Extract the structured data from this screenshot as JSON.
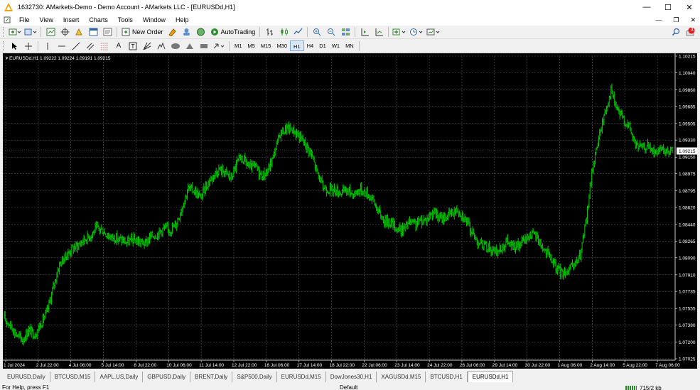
{
  "window": {
    "title": "1632730: AMarkets-Demo - Demo Account - AMarkets LLC - [EURUSDd,H1]",
    "min_label": "—",
    "max_label": "☐",
    "close_label": "✕"
  },
  "menu": {
    "items": [
      "File",
      "View",
      "Insert",
      "Charts",
      "Tools",
      "Window",
      "Help"
    ],
    "mdi_min": "—",
    "mdi_restore": "❐",
    "mdi_close": "✕"
  },
  "toolbar": {
    "new_order_label": "New Order",
    "autotrading_label": "AutoTrading",
    "notification_count": "1"
  },
  "timeframes": [
    {
      "label": "M1",
      "active": false
    },
    {
      "label": "M5",
      "active": false
    },
    {
      "label": "M15",
      "active": false
    },
    {
      "label": "M30",
      "active": false
    },
    {
      "label": "H1",
      "active": true
    },
    {
      "label": "H4",
      "active": false
    },
    {
      "label": "D1",
      "active": false
    },
    {
      "label": "W1",
      "active": false
    },
    {
      "label": "MN",
      "active": false
    }
  ],
  "chart": {
    "header": "EURUSDd,H1  1.09222 1.09224 1.09191 1.09215",
    "current_price": "1.09215",
    "colors": {
      "background": "#000000",
      "grid": "#5a5a5a",
      "candles": "#00c800",
      "axis_text": "#ffffff",
      "price_marker_bg": "#ffffff"
    }
  },
  "chart_data": {
    "type": "line",
    "title": "EURUSDd,H1",
    "ylim": [
      1.07025,
      1.10215
    ],
    "y_ticks": [
      "1.10215",
      "1.10040",
      "1.09860",
      "1.09685",
      "1.09505",
      "1.09330",
      "1.09150",
      "1.08975",
      "1.08795",
      "1.08620",
      "1.08440",
      "1.08265",
      "1.08090",
      "1.07910",
      "1.07735",
      "1.07555",
      "1.07380",
      "1.07200",
      "1.07025"
    ],
    "x_ticks": [
      "1 Jul 2024",
      "2 Jul 22:00",
      "4 Jul 06:00",
      "5 Jul 14:00",
      "8 Jul 22:00",
      "10 Jul 06:00",
      "11 Jul 14:00",
      "12 Jul 22:00",
      "16 Jul 06:00",
      "17 Jul 14:00",
      "18 Jul 22:00",
      "22 Jul 06:00",
      "23 Jul 14:00",
      "24 Jul 22:00",
      "26 Jul 06:00",
      "29 Jul 14:00",
      "30 Jul 22:00",
      "1 Aug 06:00",
      "2 Aug 14:00",
      "5 Aug 22:00",
      "7 Aug 06:00"
    ],
    "grid": true,
    "series": [
      {
        "values": [
          1.0745,
          1.0738,
          1.0728,
          1.0722,
          1.0733,
          1.0728,
          1.074,
          1.0752,
          1.0778,
          1.0802,
          1.081,
          1.0818,
          1.0822,
          1.0828,
          1.0832,
          1.084,
          1.0838,
          1.0832,
          1.083,
          1.0828,
          1.0825,
          1.0828,
          1.0826,
          1.0824,
          1.0832,
          1.0834,
          1.084,
          1.0838,
          1.0844,
          1.0862,
          1.0882,
          1.088,
          1.0872,
          1.0885,
          1.0895,
          1.0902,
          1.09,
          1.0892,
          1.091,
          1.0913,
          1.0904,
          1.0905,
          1.0895,
          1.09,
          1.0918,
          1.094,
          1.0945,
          1.0944,
          1.0938,
          1.093,
          1.092,
          1.09,
          1.0883,
          1.0881,
          1.088,
          1.0878,
          1.088,
          1.0876,
          1.0881,
          1.0878,
          1.0872,
          1.0858,
          1.0848,
          1.0847,
          1.084,
          1.0838,
          1.0846,
          1.0844,
          1.0848,
          1.085,
          1.0858,
          1.085,
          1.0852,
          1.0856,
          1.086,
          1.0852,
          1.084,
          1.0828,
          1.0822,
          1.082,
          1.0814,
          1.0818,
          1.0826,
          1.082,
          1.0822,
          1.0828,
          1.0834,
          1.083,
          1.0818,
          1.081,
          1.0798,
          1.0793,
          1.0796,
          1.08,
          1.0812,
          1.085,
          1.0905,
          1.0935,
          1.0962,
          1.0985,
          1.0965,
          1.0955,
          1.0947,
          1.0928,
          1.0925,
          1.0927,
          1.092,
          1.0921,
          1.092,
          1.0922
        ]
      }
    ]
  },
  "tabs": [
    {
      "label": "EURUSD,Daily",
      "active": false
    },
    {
      "label": "BTCUSD,M15",
      "active": false
    },
    {
      "label": "AAPL.US,Daily",
      "active": false
    },
    {
      "label": "GBPUSD,Daily",
      "active": false
    },
    {
      "label": "BRENT,Daily",
      "active": false
    },
    {
      "label": "S&P500,Daily",
      "active": false
    },
    {
      "label": "EURUSDd,M15",
      "active": false
    },
    {
      "label": "DowJones30,H1",
      "active": false
    },
    {
      "label": "XAGUSDd,M15",
      "active": false
    },
    {
      "label": "BTCUSD,H1",
      "active": false
    },
    {
      "label": "EURUSDd,H1",
      "active": true
    }
  ],
  "status": {
    "help_text": "For Help, press F1",
    "profile": "Default",
    "traffic": "715/2 kb"
  }
}
